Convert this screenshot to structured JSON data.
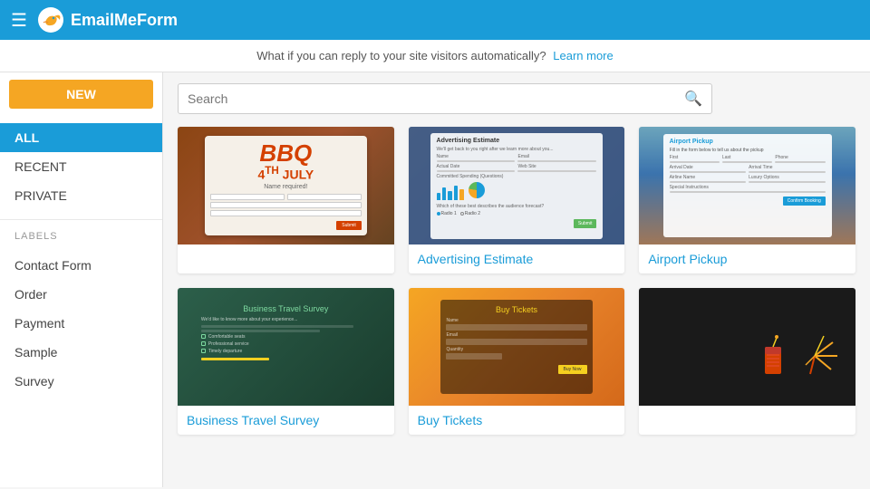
{
  "header": {
    "menu_icon": "☰",
    "logo_text": "EmailMeForm",
    "logo_bird_color": "#f5a623"
  },
  "banner": {
    "text": "What if you can reply to your site visitors automatically?",
    "link_text": "Learn more",
    "link_url": "#"
  },
  "search": {
    "placeholder": "Search"
  },
  "sidebar": {
    "new_button": "NEW",
    "items": [
      {
        "id": "all",
        "label": "ALL",
        "active": true
      },
      {
        "id": "recent",
        "label": "RECENT",
        "active": false
      },
      {
        "id": "private",
        "label": "PRIVATE",
        "active": false
      }
    ],
    "labels_heading": "LABELS",
    "label_items": [
      {
        "id": "contact-form",
        "label": "Contact Form"
      },
      {
        "id": "order",
        "label": "Order"
      },
      {
        "id": "payment",
        "label": "Payment"
      },
      {
        "id": "sample",
        "label": "Sample"
      },
      {
        "id": "survey",
        "label": "Survey"
      }
    ]
  },
  "templates": {
    "grid": [
      {
        "id": "bbq",
        "title": "",
        "type": "bbq"
      },
      {
        "id": "advertising-estimate",
        "title": "Advertising Estimate",
        "type": "advert"
      },
      {
        "id": "airport-pickup",
        "title": "Airport Pickup",
        "type": "airport"
      },
      {
        "id": "business-travel-survey",
        "title": "Business Travel Survey",
        "type": "bts"
      },
      {
        "id": "buy-tickets",
        "title": "Buy Tickets",
        "type": "buy"
      },
      {
        "id": "unknown",
        "title": "",
        "type": "firework"
      }
    ]
  }
}
